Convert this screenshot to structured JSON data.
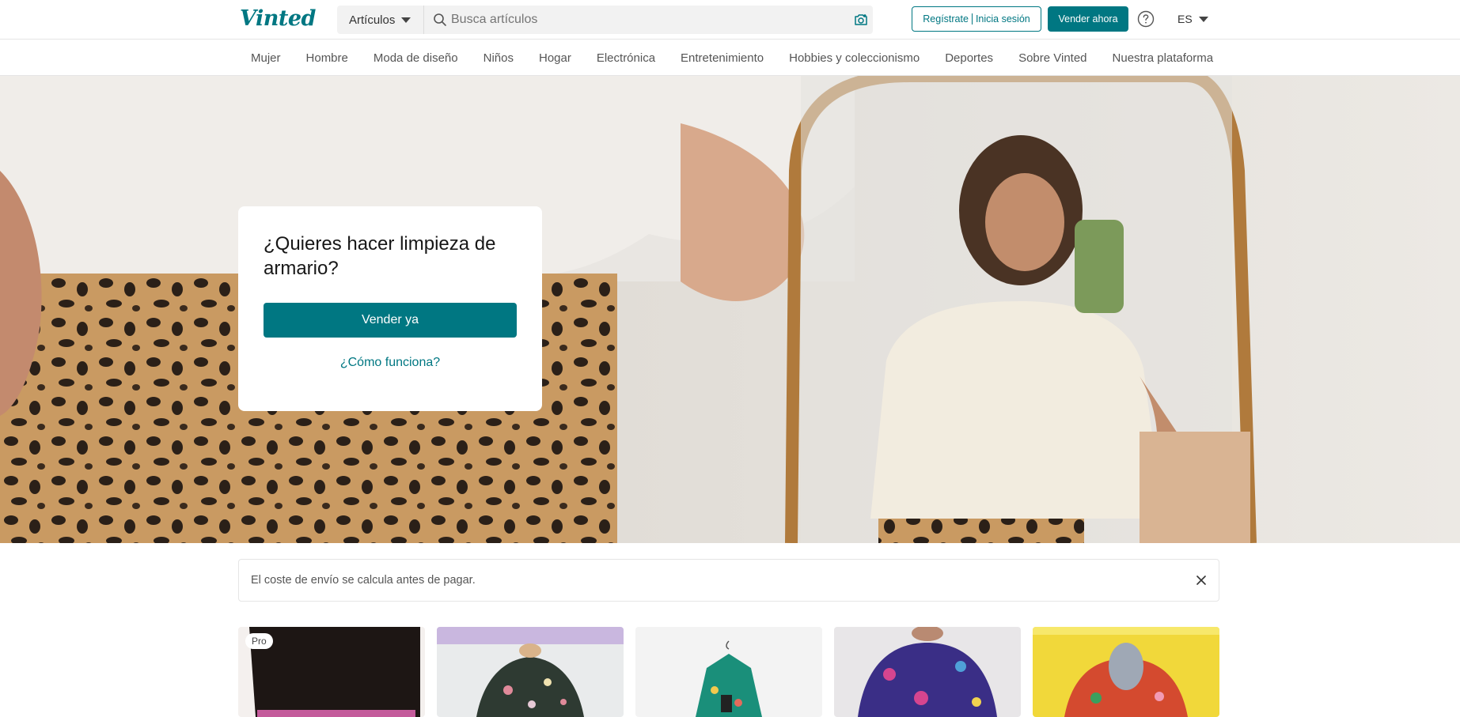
{
  "header": {
    "logo": "Vinted",
    "search": {
      "category": "Artículos",
      "placeholder": "Busca artículos",
      "icon": "search-icon",
      "camera_icon": "camera-icon"
    },
    "signup_label": "Regístrate",
    "login_label": "Inicia sesión",
    "sell_label": "Vender ahora",
    "help_icon": "help-icon",
    "language": "ES"
  },
  "categories": [
    "Mujer",
    "Hombre",
    "Moda de diseño",
    "Niños",
    "Hogar",
    "Electrónica",
    "Entretenimiento",
    "Hobbies y coleccionismo",
    "Deportes",
    "Sobre Vinted",
    "Nuestra plataforma"
  ],
  "hero": {
    "title": "¿Quieres hacer limpieza de armario?",
    "cta_label": "Vender ya",
    "link_label": "¿Cómo funciona?"
  },
  "notice": {
    "text": "El coste de envío se calcula antes de pagar.",
    "close_icon": "close-icon"
  },
  "items": [
    {
      "badge": "Pro"
    },
    {
      "badge": ""
    },
    {
      "badge": ""
    },
    {
      "badge": ""
    },
    {
      "badge": ""
    }
  ],
  "colors": {
    "brand": "#007782",
    "border": "#e5e5e5"
  }
}
